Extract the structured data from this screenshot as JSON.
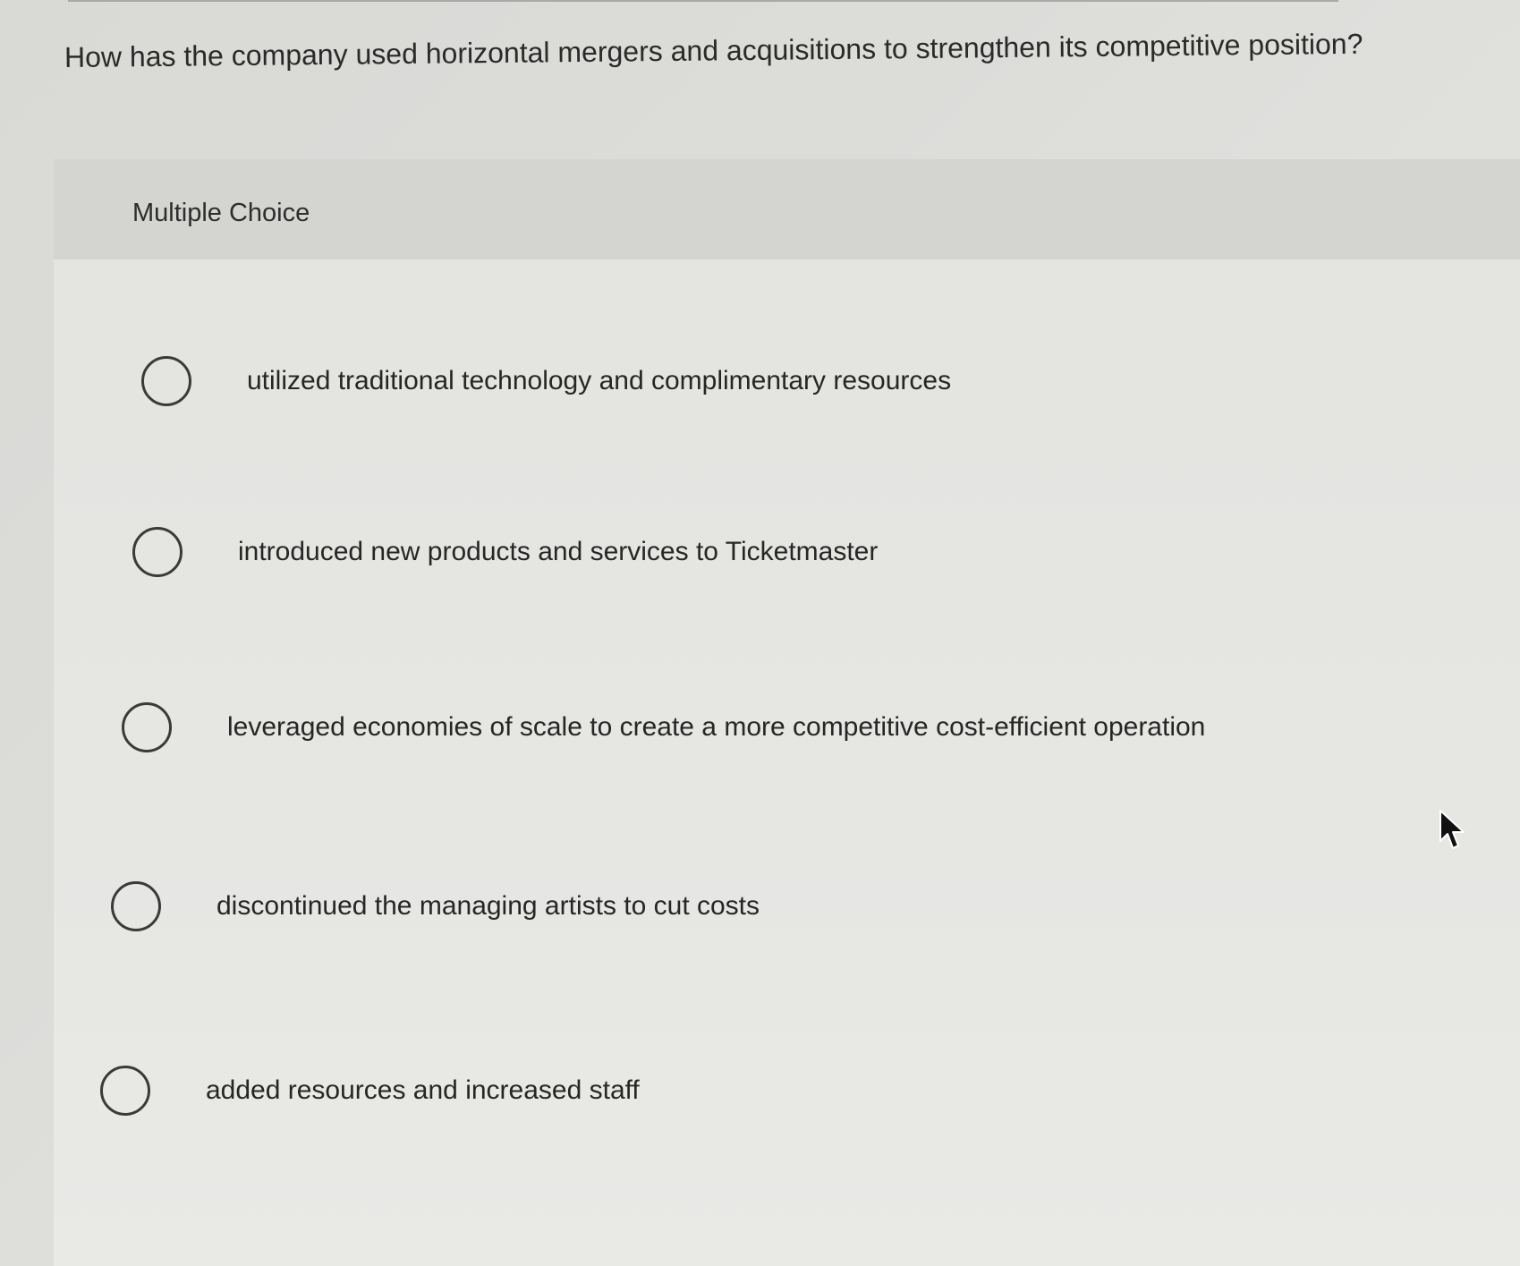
{
  "question": {
    "text": "How has the company used horizontal mergers and acquisitions to strengthen its competitive position?"
  },
  "panel": {
    "label": "Multiple Choice"
  },
  "options": [
    {
      "label": "utilized traditional technology and complimentary resources",
      "selected": false
    },
    {
      "label": "introduced new products and services to Ticketmaster",
      "selected": false
    },
    {
      "label": "leveraged economies of scale to create a more competitive cost-efficient operation",
      "selected": false
    },
    {
      "label": "discontinued the managing artists to cut costs",
      "selected": false
    },
    {
      "label": "added resources and increased staff",
      "selected": false
    }
  ],
  "icons": {
    "radio": "radio-unchecked-icon",
    "cursor": "mouse-pointer-icon"
  }
}
